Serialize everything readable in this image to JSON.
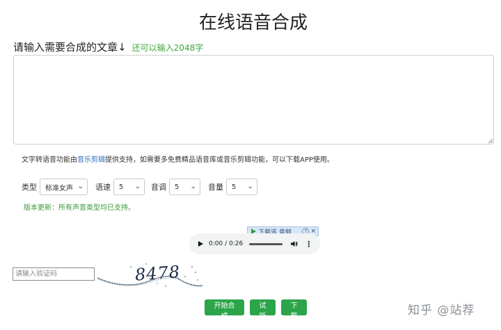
{
  "page": {
    "title": "在线语音合成"
  },
  "prompt": {
    "label": "请输入需要合成的文章↓",
    "remaining": "还可以输入2048字"
  },
  "textarea": {
    "value": "",
    "placeholder": ""
  },
  "notice": {
    "prefix": "文字转语音功能由",
    "link": "音乐剪辑",
    "suffix": "提供支持，如需要多免费精品语音库或音乐剪辑功能，可以下载APP使用。"
  },
  "options": {
    "type": {
      "label": "类型",
      "value": "标准女声"
    },
    "speed": {
      "label": "语速",
      "value": "5"
    },
    "pitch": {
      "label": "音调",
      "value": "5"
    },
    "volume": {
      "label": "音量",
      "value": "5"
    }
  },
  "update_note": "版本更新：所有声音类型均已支持。",
  "download_bar": {
    "text": "下载该 音频",
    "help": "?",
    "close": "×"
  },
  "audio": {
    "time": "0:00 / 0:26",
    "progress": 0
  },
  "captcha": {
    "placeholder": "请输入验证码",
    "code": "8478"
  },
  "buttons": {
    "start": "开始合成",
    "listen": "试听",
    "download": "下载"
  },
  "watermark": "知乎 @站荐",
  "colors": {
    "accent_green": "#2ca54a",
    "hint_green": "#3aa53a",
    "link_blue": "#2a6ebb"
  }
}
